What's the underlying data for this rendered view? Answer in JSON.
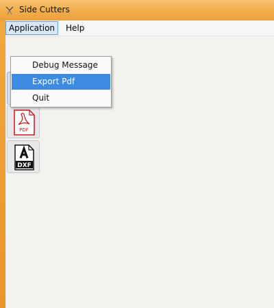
{
  "window": {
    "title": "Side Cutters"
  },
  "menubar": {
    "items": [
      {
        "label": "Application"
      },
      {
        "label": "Help"
      }
    ]
  },
  "dropdown": {
    "items": [
      {
        "label": "Debug Message"
      },
      {
        "label": "Export Pdf",
        "selected": true
      },
      {
        "label": "Quit"
      }
    ]
  },
  "toolbar": {
    "tools": [
      {
        "icon": "line-tool-icon"
      },
      {
        "icon": "pdf-file-icon",
        "text": "PDF"
      },
      {
        "icon": "dxf-file-icon",
        "text": "DXF"
      }
    ]
  },
  "colors": {
    "title_bar": "#f2b04f",
    "selection": "#3c8be0",
    "client_bg": "#f4f2ef"
  }
}
